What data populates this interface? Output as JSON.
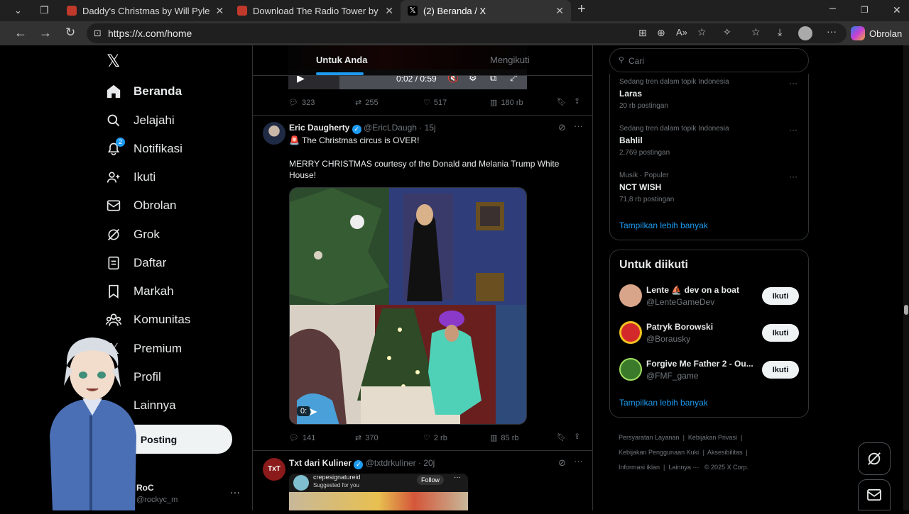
{
  "browser": {
    "tabs": [
      {
        "title": "Daddy's Christmas by Will Pyle",
        "favicon_color": "#c0392b"
      },
      {
        "title": "Download The Radio Tower by Zac",
        "favicon_color": "#c0392b"
      },
      {
        "title": "(2) Beranda / X",
        "favicon_color": "#000000",
        "active": true
      }
    ],
    "url": "https://x.com/home",
    "copilot_label": "Obrolan"
  },
  "nav": {
    "items": [
      {
        "label": "Beranda",
        "icon": "home-icon",
        "active": true
      },
      {
        "label": "Jelajahi",
        "icon": "search-icon"
      },
      {
        "label": "Notifikasi",
        "icon": "bell-icon",
        "badge": "2"
      },
      {
        "label": "Ikuti",
        "icon": "add-person-icon"
      },
      {
        "label": "Obrolan",
        "icon": "mail-icon"
      },
      {
        "label": "Grok",
        "icon": "grok-icon"
      },
      {
        "label": "Daftar",
        "icon": "list-icon"
      },
      {
        "label": "Markah",
        "icon": "bookmark-icon"
      },
      {
        "label": "Komunitas",
        "icon": "people-icon"
      },
      {
        "label": "Premium",
        "icon": "x-logo-icon"
      },
      {
        "label": "Profil",
        "icon": "person-icon"
      },
      {
        "label": "Lainnya",
        "icon": "more-icon"
      }
    ],
    "post_button": "Posting",
    "account": {
      "name": "RoC",
      "handle": "@rockyc_m"
    }
  },
  "timeline": {
    "tabs": [
      {
        "label": "Untuk Anda",
        "active": true
      },
      {
        "label": "Mengikuti"
      }
    ],
    "top_video": {
      "time": "0:02 / 0:59"
    },
    "top_actions": {
      "replies": "323",
      "reposts": "255",
      "likes": "517",
      "views": "180 rb"
    },
    "tweet": {
      "name": "Eric Daugherty",
      "handle": "@EricLDaugh",
      "time": "15j",
      "line1": "🚨 The Christmas circus is OVER!",
      "body": "MERRY CHRISTMAS courtesy of the Donald and Melania Trump White House!",
      "video_time": "0:",
      "actions": {
        "replies": "141",
        "reposts": "370",
        "likes": "2 rb",
        "views": "85 rb"
      }
    },
    "tweet2": {
      "name": "Txt dari Kuliner",
      "handle": "@txtdrkuliner",
      "time": "20j",
      "embed_account": "crepesignatureid",
      "embed_sub": "Suggested for you",
      "embed_follow": "Follow"
    }
  },
  "right": {
    "search_placeholder": "Cari",
    "trends": [
      {
        "context": "Sedang tren dalam topik Indonesia",
        "name": "Laras",
        "count": "20 rb postingan"
      },
      {
        "context": "Sedang tren dalam topik Indonesia",
        "name": "Bahlil",
        "count": "2.769 postingan"
      },
      {
        "context": "Musik · Populer",
        "name": "NCT WISH",
        "count": "71,8 rb postingan"
      }
    ],
    "trends_more": "Tampilkan lebih banyak",
    "follow_title": "Untuk diikuti",
    "follow": [
      {
        "name": "Lente ⛵ dev on a boat",
        "handle": "@LenteGameDev",
        "button": "Ikuti",
        "avatar_color": "#d9a58a"
      },
      {
        "name": "Patryk Borowski",
        "handle": "@Borausky",
        "button": "Ikuti",
        "avatar_color": "#d4292b"
      },
      {
        "name": "Forgive Me Father 2 - Ou...",
        "handle": "@FMF_game",
        "button": "Ikuti",
        "avatar_color": "#3b7a2a"
      }
    ],
    "follow_more": "Tampilkan lebih banyak",
    "footer": [
      "Persyaratan Layanan",
      "Kebijakan Privasi",
      "Kebijakan Penggunaan Kuki",
      "Aksesibilitas",
      "Informasi iklan",
      "Lainnya ···",
      "© 2025 X Corp."
    ]
  }
}
